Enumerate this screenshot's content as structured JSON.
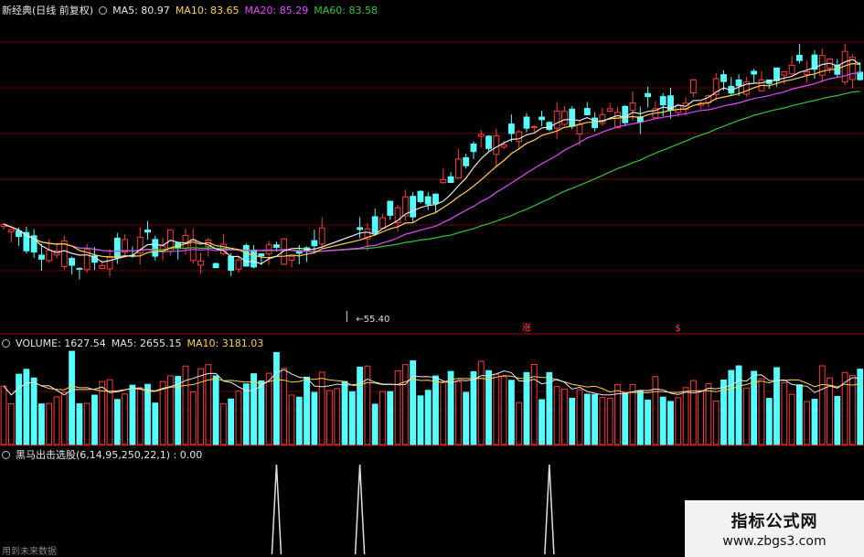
{
  "colors": {
    "up": "#ff3b3b",
    "down": "#54ffff",
    "ma5": "#e6e6e6",
    "ma10": "#ffd24d",
    "ma20": "#e04bff",
    "ma60": "#35c435",
    "grid": "#6a0000",
    "separator": "#b00000",
    "spike": "#e0e0e0"
  },
  "price_header": {
    "title": "新经典(日线 前复权)",
    "ma5": "MA5: 80.97",
    "ma10": "MA10: 83.65",
    "ma20": "MA20: 85.29",
    "ma60": "MA60: 83.58"
  },
  "volume_header": {
    "volume": "VOLUME: 1627.54",
    "ma5": "MA5: 2655.15",
    "ma10": "MA10: 3181.03"
  },
  "indicator_header": {
    "label": "黑马出击选股(6,14,95,250,22,1) : 0.00"
  },
  "footer_text": "用到未来数据",
  "watermark": {
    "line1": "指标公式网",
    "line2": "www.zbgs3.com"
  },
  "chart_data": [
    {
      "type": "candlestick",
      "title": "新经典(日线 前复权)",
      "series_names": [
        "MA5",
        "MA10",
        "MA20",
        "MA60"
      ],
      "annotations": [
        {
          "text": "55.40",
          "index": 46,
          "value": 55.4
        },
        {
          "text": "涨",
          "index": 69
        },
        {
          "text": "$",
          "index": 89
        }
      ],
      "ohlc_approx": {
        "index": [
          0,
          10,
          20,
          30,
          40,
          55,
          62,
          70,
          80,
          88,
          110,
          113
        ],
        "close": [
          66,
          61,
          64,
          62,
          63,
          69,
          76,
          79,
          81,
          83,
          88,
          86
        ]
      },
      "ylim_approx": [
        55,
        95
      ]
    },
    {
      "type": "bar",
      "title": "VOLUME",
      "last": {
        "volume": 1627.54,
        "ma5": 2655.15,
        "ma10": 3181.03
      }
    },
    {
      "type": "line",
      "title": "黑马出击选股(6,14,95,250,22,1)",
      "value": 0.0,
      "signal_indices": [
        36,
        47,
        72
      ]
    }
  ]
}
